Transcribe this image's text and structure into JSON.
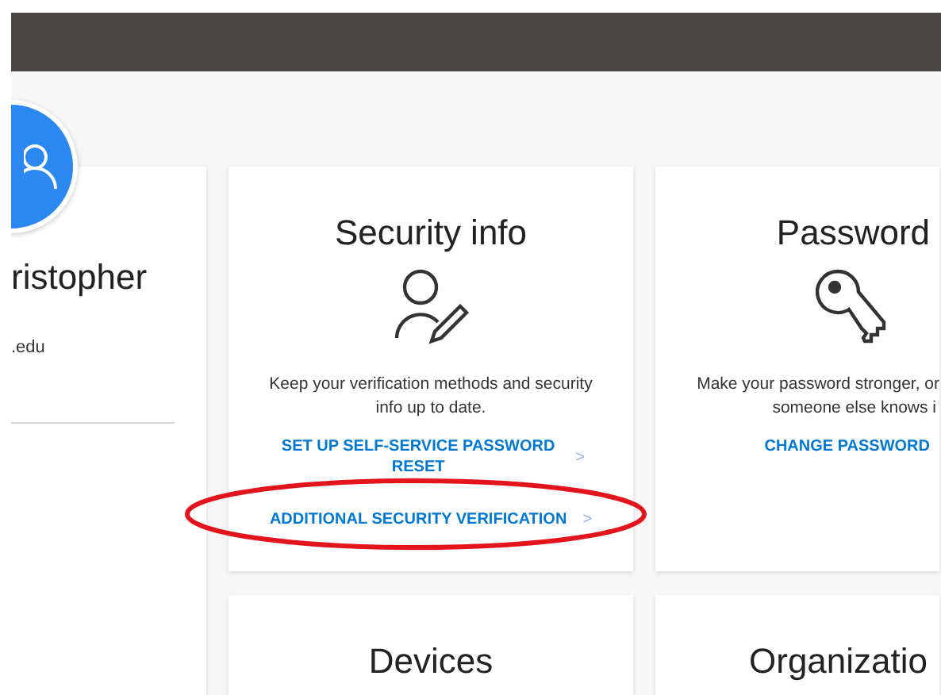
{
  "profile": {
    "name": "ristopher",
    "email": ".edu"
  },
  "cards": [
    {
      "title": "Security info",
      "description": "Keep your verification methods and security info up to date.",
      "links": [
        {
          "label": "SET UP SELF-SERVICE PASSWORD RESET",
          "chevron": ">"
        },
        {
          "label": "ADDITIONAL SECURITY VERIFICATION",
          "chevron": ">"
        }
      ]
    },
    {
      "title": "Password",
      "description_lines": [
        "Make your password stronger, or",
        "someone else knows i"
      ],
      "links": [
        {
          "label": "CHANGE PASSWORD"
        }
      ]
    }
  ],
  "lower_cards": [
    {
      "title": "Devices"
    },
    {
      "title": "Organizatio"
    }
  ],
  "annotation": {
    "kind": "ellipse"
  }
}
